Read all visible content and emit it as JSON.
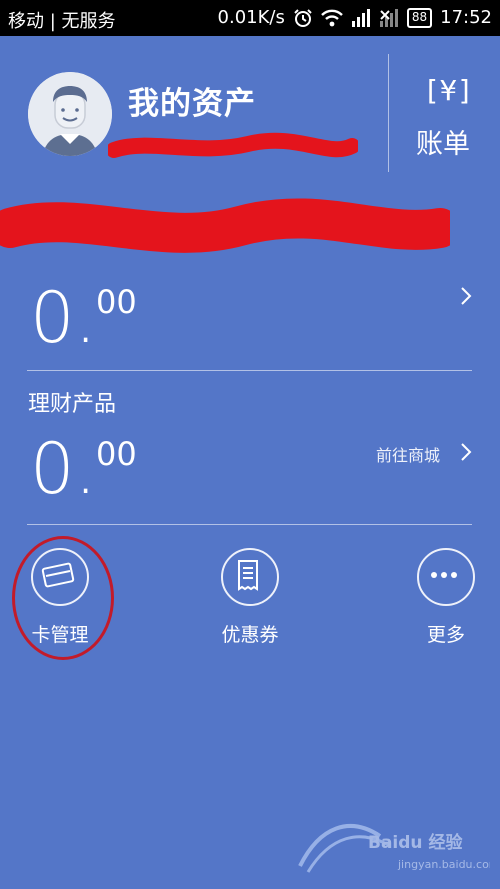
{
  "statusbar": {
    "carrier": "移动 | 无服务",
    "speed": "0.01K/s",
    "battery": "88",
    "time": "17:52"
  },
  "header": {
    "title": "我的资产",
    "bill_symbol": "[¥]",
    "bill_label": "账单"
  },
  "balance": {
    "whole": "0.",
    "cents": "00"
  },
  "wealth": {
    "label": "理财产品",
    "whole": "0.",
    "cents": "00",
    "link": "前往商城"
  },
  "actions": [
    {
      "label": "卡管理",
      "icon": "card-icon"
    },
    {
      "label": "优惠券",
      "icon": "coupon-icon"
    },
    {
      "label": "更多",
      "icon": "more-icon"
    }
  ],
  "colors": {
    "background": "#5476c8",
    "redact": "#e4141c",
    "highlight": "#c21b2a"
  }
}
